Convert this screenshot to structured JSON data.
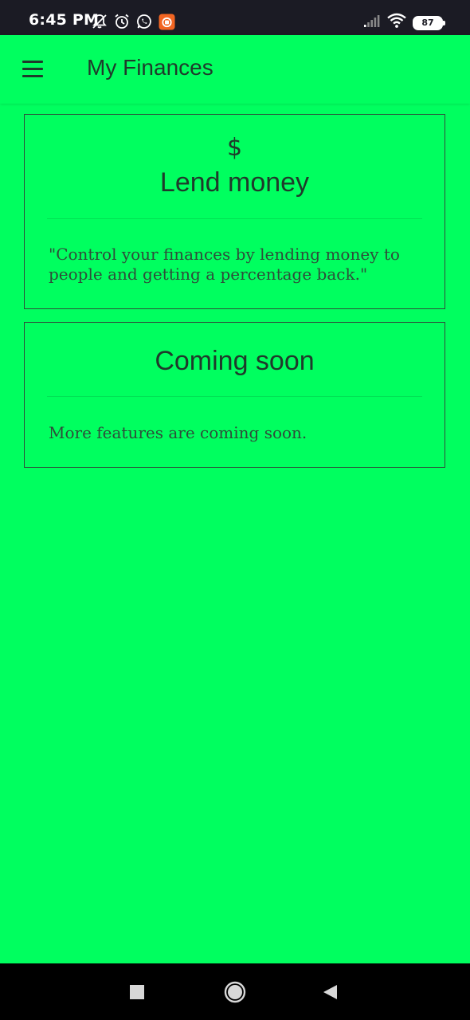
{
  "status_bar": {
    "time": "6:45 PM",
    "battery_level": "87",
    "left_icons": [
      "notifications-off-icon",
      "alarm-icon",
      "whatsapp-icon",
      "app-notification-icon"
    ],
    "right_icons": [
      "signal-icon",
      "wifi-icon",
      "battery-icon"
    ]
  },
  "app_bar": {
    "title": "My Finances",
    "menu_icon": "hamburger-menu-icon"
  },
  "cards": [
    {
      "icon": "$",
      "title": "Lend money",
      "text": "\"Control your finances by lending money to people and getting a percentage back.\""
    },
    {
      "title": "Coming soon",
      "text": "More features are coming soon."
    }
  ],
  "nav_bar": {
    "buttons": [
      "recents-icon",
      "home-icon",
      "back-icon"
    ]
  },
  "colors": {
    "background": "#00ff5f",
    "status_bar": "#1b1b24",
    "text_dark": "#1f3a2b",
    "nav_bar": "#000000",
    "app_badge": "#f26522"
  }
}
